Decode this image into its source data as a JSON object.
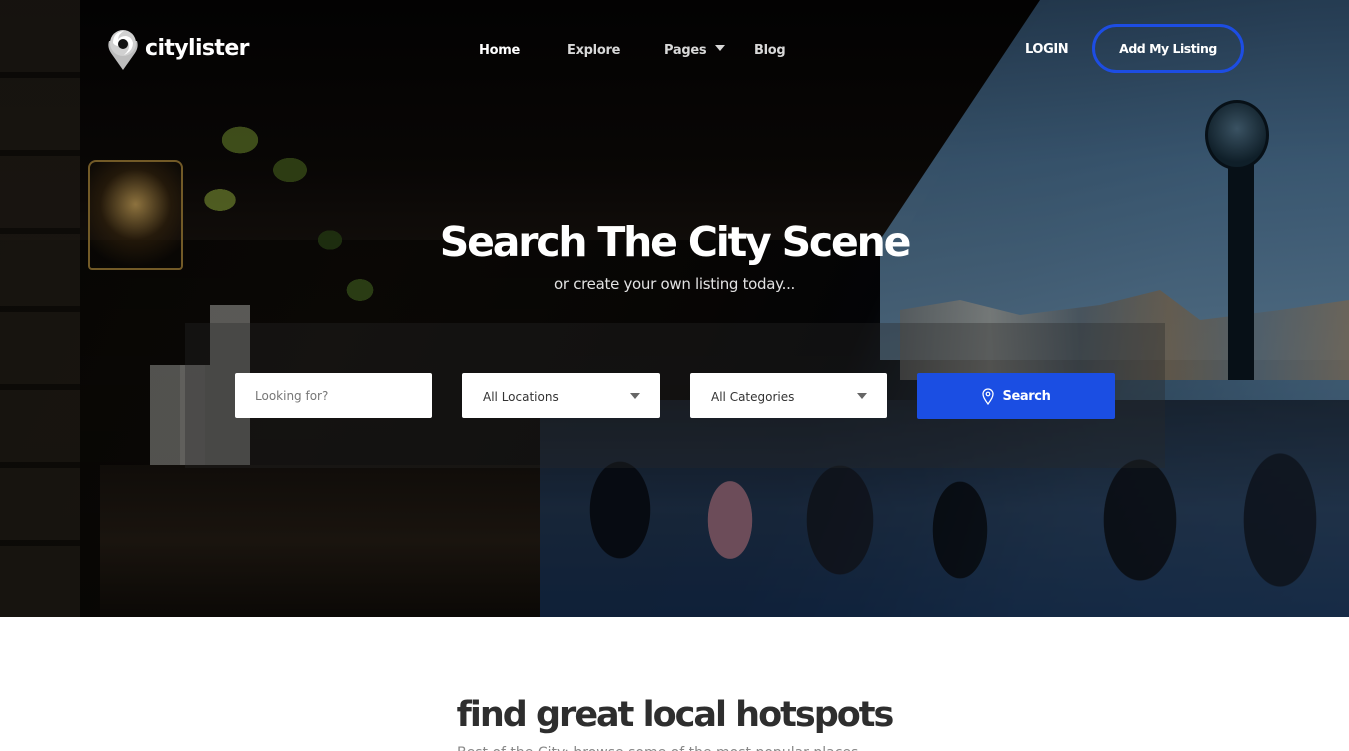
{
  "brand": {
    "name": "citylister",
    "logo_icon": "map-pin-swirl-icon"
  },
  "nav": {
    "items": [
      {
        "label": "Home",
        "active": true
      },
      {
        "label": "Explore",
        "active": false
      },
      {
        "label": "Pages",
        "active": false,
        "has_dropdown": true
      },
      {
        "label": "Blog",
        "active": false
      }
    ],
    "login_label": "LOGIN",
    "add_listing_label": "Add My Listing"
  },
  "hero": {
    "title": "Search The City Scene",
    "subtitle": "or create your own listing today..."
  },
  "search": {
    "keyword_placeholder": "Looking for?",
    "location_selected": "All Locations",
    "category_selected": "All Categories",
    "button_label": "Search",
    "button_icon": "map-pin-icon"
  },
  "section": {
    "title": "find great local hotspots",
    "subtitle": "Best of the City: browse some of the most popular places"
  },
  "colors": {
    "accent": "#1b4ee3",
    "heading": "#2e2e2e",
    "white": "#ffffff"
  }
}
